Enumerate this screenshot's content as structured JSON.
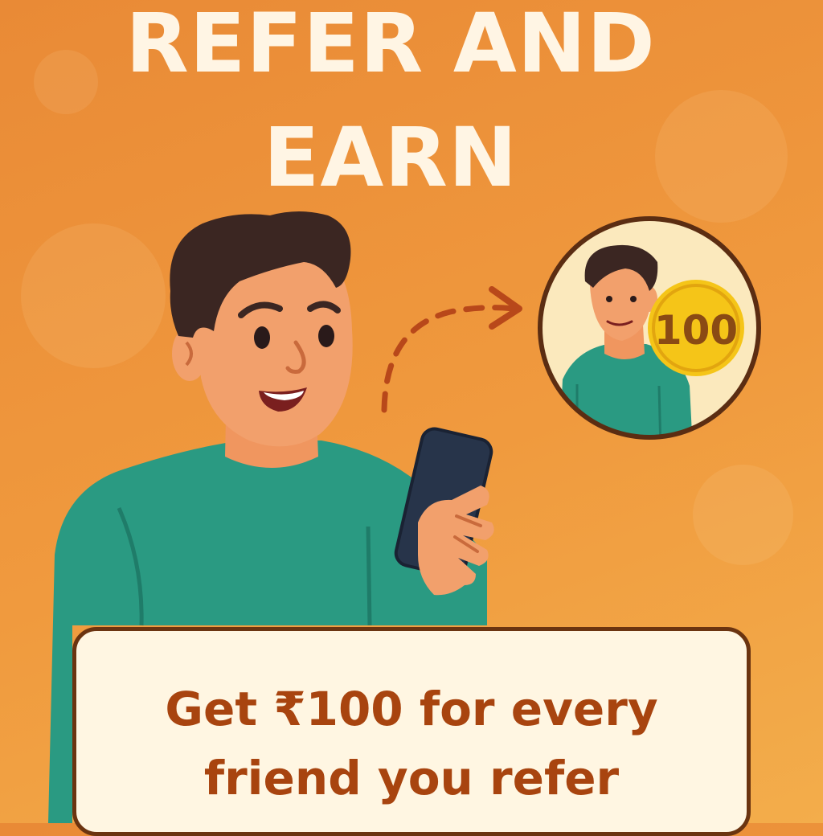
{
  "headline": {
    "line1": "REFER AND",
    "line2": "EARN"
  },
  "coin": {
    "amount": "100",
    "color": "#f5c518"
  },
  "message": {
    "line1": "Get ₹100 for every",
    "line2": "friend you refer"
  },
  "colors": {
    "background": "#ef9339",
    "headline": "#fff5e4",
    "shirt": "#2a9a82",
    "hair": "#3b2622",
    "skin": "#f2a06c",
    "phone": "#27344a",
    "arrow": "#b8481a",
    "card_background": "#fff6e2",
    "card_border": "#6b3410",
    "message_text": "#a8440f"
  },
  "icons": {
    "arrow": "dashed-curved-arrow-icon",
    "coin": "coin-icon"
  }
}
